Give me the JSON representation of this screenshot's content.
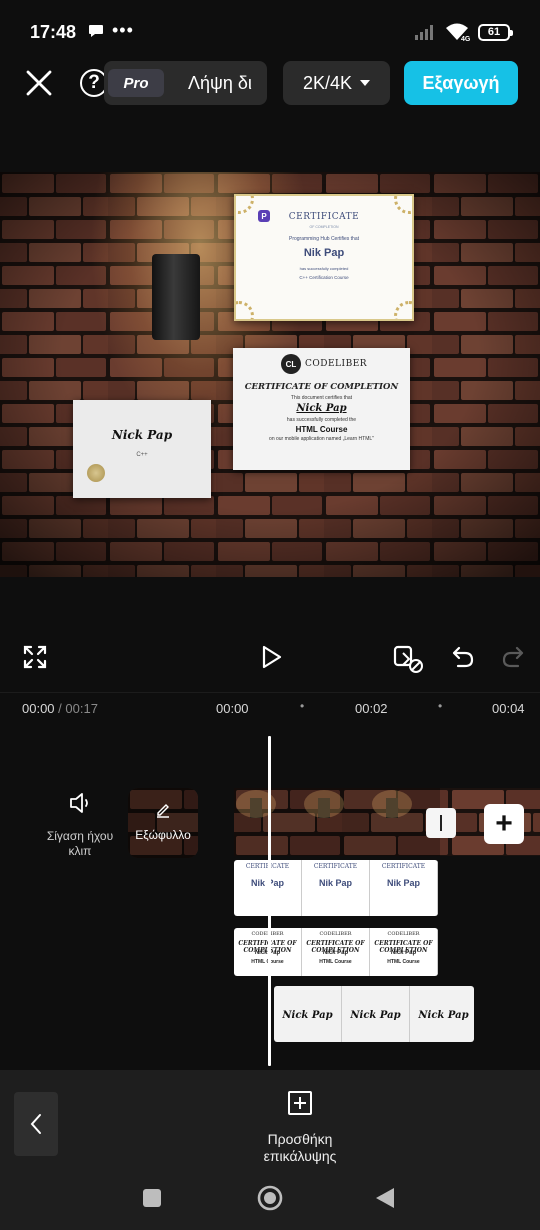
{
  "status": {
    "time": "17:48",
    "battery": "61",
    "network": "4G"
  },
  "topbar": {
    "pro_badge": "Pro",
    "pro_text": "Λήψη δι",
    "resolution": "2K/4K",
    "export_label": "Εξαγωγή",
    "help": "?"
  },
  "preview": {
    "cert1": {
      "title": "CERTIFICATE",
      "subtitle": "OF COMPLETION",
      "line1": "Programming Hub Certifies that",
      "name": "Nik Pap",
      "line2": "has successfully completed",
      "line3": "C++ Certification Course"
    },
    "cert2": {
      "brand": "CODELIBER",
      "title": "CERTIFICATE OF COMPLETION",
      "line1": "This document certifies that",
      "name": "Nick Pap",
      "line2": "has successfully completed the",
      "course": "HTML Course",
      "line3": "on our mobile application named „Learn HTML\""
    },
    "cert3": {
      "name": "Nick Pap",
      "lang": "C++"
    }
  },
  "ruler": {
    "current": "00:00",
    "duration": "/ 00:17",
    "marks": [
      "00:00",
      "00:02",
      "00:04"
    ]
  },
  "timeline": {
    "mute_label": "Σίγαση ήχου κλιπ",
    "cover_label": "Εξώφυλλο",
    "overlay1": {
      "title": "CERTIFICATE",
      "name": "Nik Pap"
    },
    "overlay2": {
      "brand": "CODELIBER",
      "title": "CERTIFICATE OF COMPLETION",
      "name": "Nick Pap",
      "course": "HTML Course"
    },
    "overlay3": {
      "name": "Nick Pap"
    }
  },
  "bottombar": {
    "add_overlay_label": "Προσθήκη επικάλυψης"
  },
  "colors": {
    "accent": "#16c1e6",
    "background": "#0e0e0e",
    "panel": "#1e1e1e"
  },
  "icons": {
    "close": "close-icon",
    "help": "help-icon",
    "fullscreen": "fullscreen-icon",
    "play": "play-icon",
    "keyframe": "keyframe-icon",
    "undo": "undo-icon",
    "redo": "redo-icon",
    "mute": "speaker-icon",
    "edit": "edit-icon",
    "add": "plus-icon",
    "back": "chevron-left-icon",
    "add_overlay": "add-overlay-icon"
  }
}
